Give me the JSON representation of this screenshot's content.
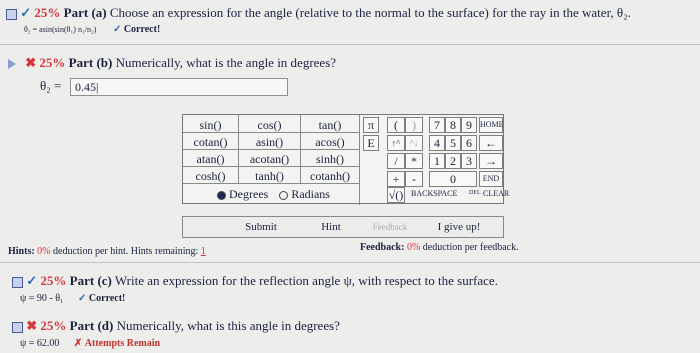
{
  "part_a": {
    "percent": "25%",
    "label": "Part (a)",
    "question": "Choose an expression for the angle (relative to the normal to the surface) for the ray in the water, θ₂.",
    "answer_expr": "θ₂ = asin(sin(θ₁) n₁/n₂)",
    "status": "Correct!"
  },
  "part_b": {
    "percent": "25%",
    "label": "Part (b)",
    "question": "Numerically, what is the angle in degrees?",
    "var_label": "θ₂ =",
    "input_value": "0.45|"
  },
  "keypad": {
    "functions": [
      [
        "sin()",
        "cos()",
        "tan()"
      ],
      [
        "cotan()",
        "asin()",
        "acos()"
      ],
      [
        "atan()",
        "acotan()",
        "sinh()"
      ],
      [
        "cosh()",
        "tanh()",
        "cotanh()"
      ]
    ],
    "degrees_label": "Degrees",
    "radians_label": "Radians",
    "symbols": [
      "π",
      "(",
      ")",
      "E",
      "↑^",
      "^↓",
      "/",
      "*",
      "+",
      "-",
      "√()"
    ],
    "digits": [
      "7",
      "8",
      "9",
      "4",
      "5",
      "6",
      "1",
      "2",
      "3",
      "0"
    ],
    "home": "HOME",
    "left_arrow": "←",
    "right_arrow": "→",
    "end": "END",
    "backspace": "BACKSPACE",
    "del": "DEL",
    "clear": "CLEAR"
  },
  "buttons": {
    "submit": "Submit",
    "hint": "Hint",
    "feedback": "Feedback",
    "give_up": "I give up!"
  },
  "hints": {
    "label": "Hints:",
    "percent": "0%",
    "text": "deduction per hint. Hints remaining:",
    "remaining": "1"
  },
  "feedback": {
    "label": "Feedback:",
    "percent": "0%",
    "text": "deduction per feedback."
  },
  "part_c": {
    "percent": "25%",
    "label": "Part (c)",
    "question": "Write an expression for the reflection angle ψ, with respect to the surface.",
    "answer_expr": "ψ = 90 - θ₁",
    "status": "Correct!"
  },
  "part_d": {
    "percent": "25%",
    "label": "Part (d)",
    "question": "Numerically, what is this angle in degrees?",
    "answer_expr": "ψ = 62.00",
    "status": "Attempts Remain"
  }
}
